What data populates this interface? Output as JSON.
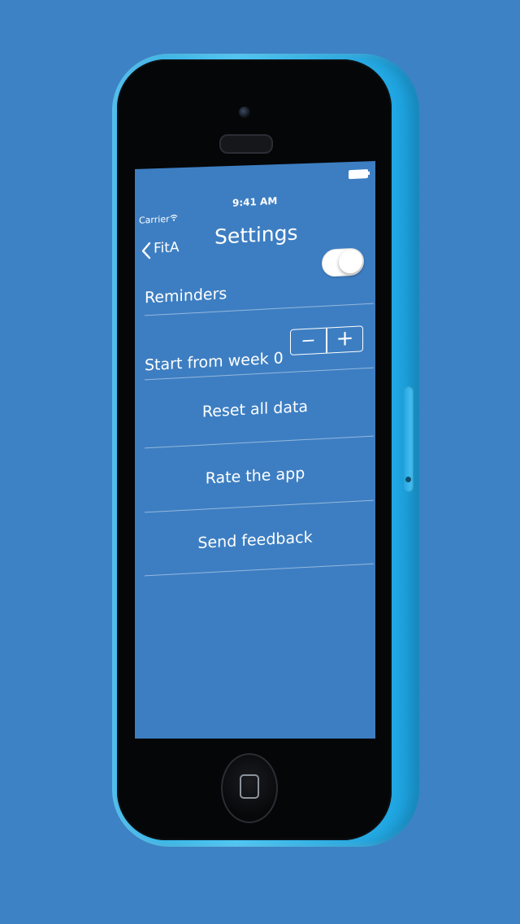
{
  "status_bar": {
    "carrier": "Carrier",
    "time": "9:41 AM"
  },
  "nav": {
    "back_label": "FitA",
    "title": "Settings"
  },
  "settings": {
    "reminders_label": "Reminders",
    "reminders_on": true,
    "week_label": "Start from week 0",
    "stepper_minus": "−",
    "stepper_plus": "+"
  },
  "actions": {
    "reset": "Reset all data",
    "rate": "Rate the app",
    "feedback": "Send feedback"
  },
  "colors": {
    "background": "#3d82c4",
    "screen": "#3d7ec2",
    "phone_shell": "#35bdf2"
  }
}
